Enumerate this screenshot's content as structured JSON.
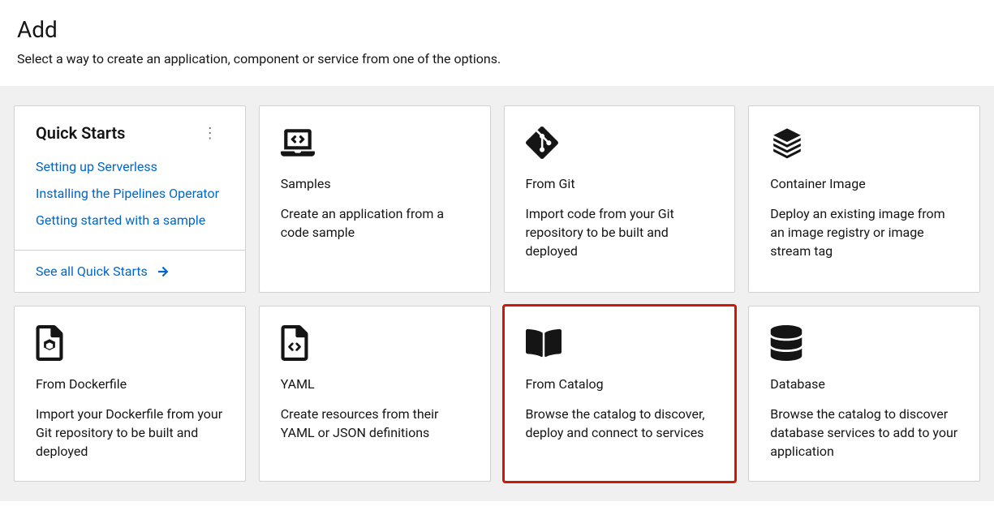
{
  "header": {
    "title": "Add",
    "subtitle": "Select a way to create an application, component or service from one of the options."
  },
  "quickStarts": {
    "title": "Quick Starts",
    "links": [
      "Setting up Serverless",
      "Installing the Pipelines Operator",
      "Getting started with a sample"
    ],
    "seeAll": "See all Quick Starts"
  },
  "cards": {
    "samples": {
      "title": "Samples",
      "desc": "Create an application from a code sample"
    },
    "fromGit": {
      "title": "From Git",
      "desc": "Import code from your Git repository to be built and deployed"
    },
    "containerImage": {
      "title": "Container Image",
      "desc": "Deploy an existing image from an image registry or image stream tag"
    },
    "fromDockerfile": {
      "title": "From Dockerfile",
      "desc": "Import your Dockerfile from your Git repository to be built and deployed"
    },
    "yaml": {
      "title": "YAML",
      "desc": "Create resources from their YAML or JSON definitions"
    },
    "fromCatalog": {
      "title": "From Catalog",
      "desc": "Browse the catalog to discover, deploy and connect to services"
    },
    "database": {
      "title": "Database",
      "desc": "Browse the catalog to discover database services to add to your application"
    }
  }
}
